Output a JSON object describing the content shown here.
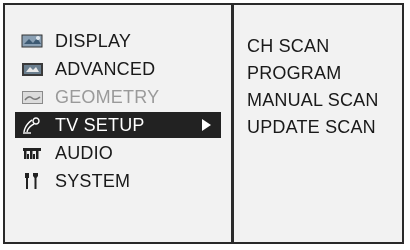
{
  "menu": {
    "items": [
      {
        "label": "DISPLAY",
        "icon": "display-icon"
      },
      {
        "label": "ADVANCED",
        "icon": "advanced-icon"
      },
      {
        "label": "GEOMETRY",
        "icon": "geometry-icon",
        "state": "disabled"
      },
      {
        "label": "TV SETUP",
        "icon": "tv-setup-icon",
        "state": "selected"
      },
      {
        "label": "AUDIO",
        "icon": "audio-icon"
      },
      {
        "label": "SYSTEM",
        "icon": "system-icon"
      }
    ]
  },
  "submenu": {
    "items": [
      {
        "label": "CH SCAN"
      },
      {
        "label": "PROGRAM"
      },
      {
        "label": "MANUAL SCAN"
      },
      {
        "label": "UPDATE SCAN"
      }
    ]
  },
  "colors": {
    "border": "#2a2a2a",
    "background": "#f2f2f2",
    "selected_bg": "#222222",
    "disabled_text": "#9a9a9a"
  }
}
